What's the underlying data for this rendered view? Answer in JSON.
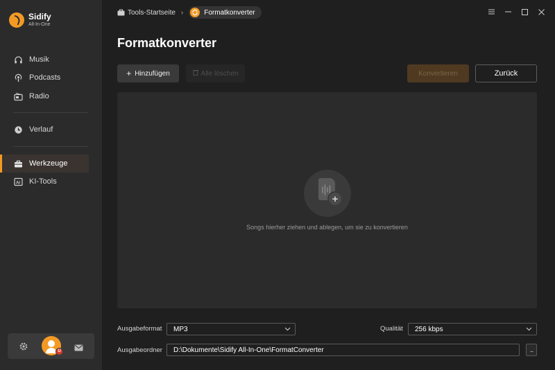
{
  "app": {
    "name": "Sidify",
    "subtitle": "All-In-One",
    "accent_color": "#f39a25"
  },
  "sidebar": {
    "items": [
      {
        "label": "Musik",
        "icon": "headphones-icon"
      },
      {
        "label": "Podcasts",
        "icon": "podcast-icon"
      },
      {
        "label": "Radio",
        "icon": "radio-icon"
      },
      {
        "label": "Verlauf",
        "icon": "history-icon"
      },
      {
        "label": "Werkzeuge",
        "icon": "toolbox-icon",
        "active": true
      },
      {
        "label": "KI-Tools",
        "icon": "ai-icon"
      }
    ],
    "bottom": {
      "badge": "U"
    }
  },
  "breadcrumb": {
    "home": "Tools-Startseite",
    "current": "Formatkonverter"
  },
  "window_controls": [
    "menu-icon",
    "minimize-icon",
    "maximize-icon",
    "close-icon"
  ],
  "page": {
    "title": "Formatkonverter"
  },
  "toolbar": {
    "add_label": "Hinzufügen",
    "clear_label": "Alle löschen",
    "convert_label": "Konvertieren",
    "back_label": "Zurück"
  },
  "dropzone": {
    "hint": "Songs hierher ziehen und ablegen, um sie zu konvertieren"
  },
  "settings": {
    "output_format_label": "Ausgabeformat",
    "output_format_value": "MP3",
    "quality_label": "Qualität",
    "quality_value": "256 kbps",
    "output_folder_label": "Ausgabeordner",
    "output_folder_value": "D:\\Dokumente\\Sidify All-In-One\\FormatConverter",
    "browse_label": "..."
  }
}
